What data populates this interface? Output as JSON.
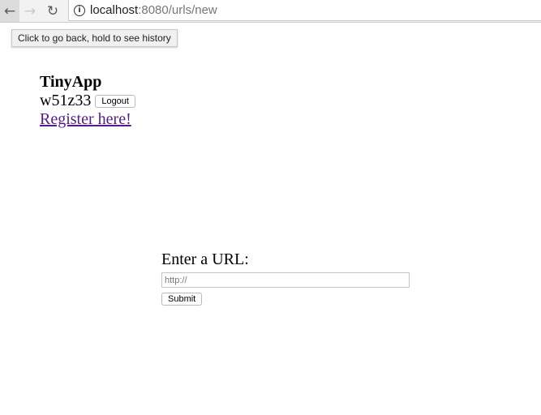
{
  "browser": {
    "url_host": "localhost",
    "url_rest": ":8080/urls/new",
    "back_tooltip": "Click to go back, hold to see history",
    "back_icon": "arrow-left",
    "forward_icon": "arrow-right",
    "reload_icon": "reload",
    "info_icon": "info"
  },
  "header": {
    "brand": "TinyApp",
    "username": "w51z33",
    "logout_label": "Logout",
    "register_link": "Register here! "
  },
  "form": {
    "label": "Enter a URL:",
    "url_placeholder": "http://",
    "url_value": "",
    "submit_label": "Submit"
  }
}
